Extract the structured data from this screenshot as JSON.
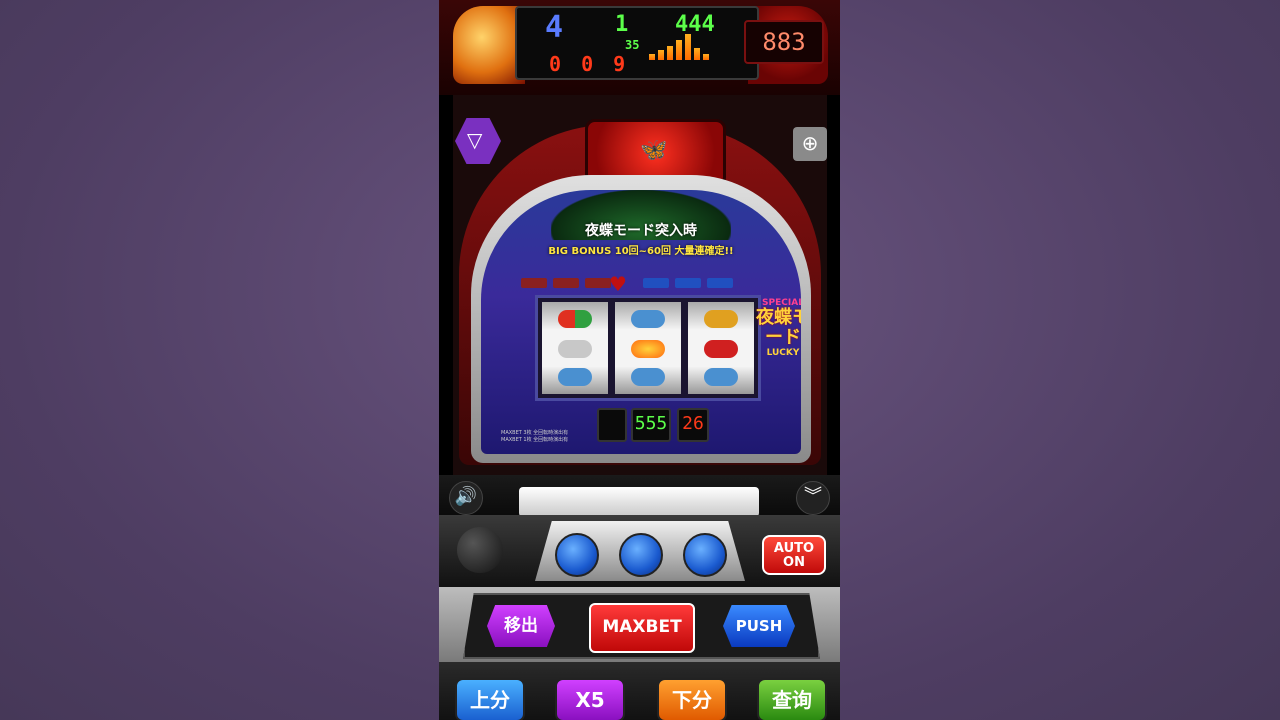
{
  "display": {
    "digit_big": "4",
    "digit_a": "1",
    "digit_b": "444",
    "digit_mid": "35",
    "digits_row": "0 0 9",
    "counter": "883"
  },
  "panel": {
    "banner_title": "夜蝶モード突入時",
    "banner_sub": "BIG BONUS 10回~60回 大量連確定!!",
    "special_top": "SPECIAL",
    "special_main": "夜蝶モード",
    "special_bottom": "LUCKY",
    "lcd_left": "555",
    "lcd_right": "26",
    "maxbet_note_1": "MAXBET 3枚 全回転時演出有",
    "maxbet_note_2": "MAXBET 1枚 全回転時演出有"
  },
  "controls": {
    "auto_label": "AUTO\nON",
    "move_label": "移出",
    "maxbet_label": "MAXBET",
    "push_label": "PUSH",
    "up_label": "上分",
    "x5_label": "X5",
    "down_label": "下分",
    "query_label": "查询"
  },
  "icons": {
    "menu": "triangle-down-icon",
    "zoom": "zoom-in-icon",
    "sound": "speaker-icon",
    "collapse": "double-chevron-down-icon"
  },
  "colors": {
    "background": "#5a4670",
    "accent_red": "#c00808",
    "accent_blue": "#1a5acf",
    "accent_purple": "#a020d0",
    "accent_orange": "#ff7a10",
    "accent_green": "#3aa018"
  }
}
